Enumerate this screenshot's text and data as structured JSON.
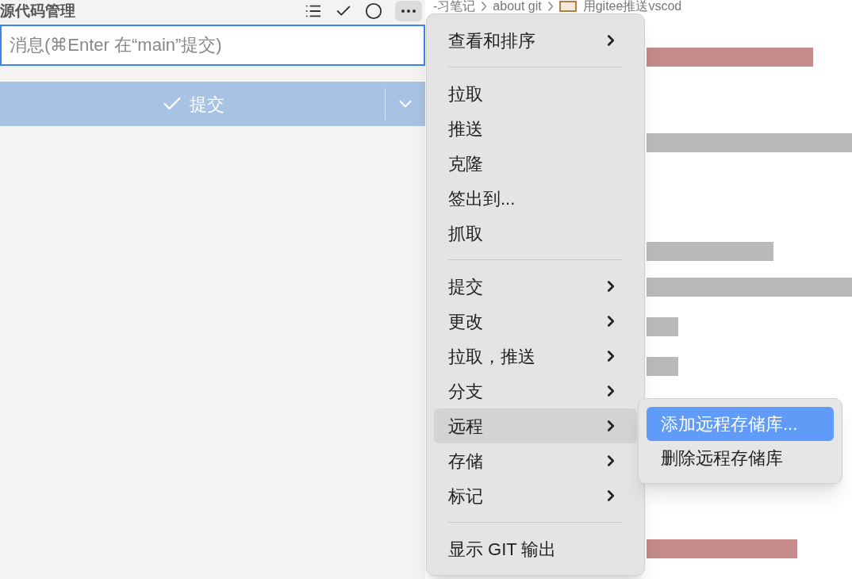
{
  "sidebar": {
    "title": "源代码管理",
    "message_field": {
      "placeholder": "消息(⌘Enter 在“main”提交)"
    },
    "commit_button": {
      "label": "提交"
    }
  },
  "breadcrumb": [
    "-习笔记",
    "about git",
    "用gitee推送vscod"
  ],
  "menu": {
    "sections": [
      [
        {
          "label": "查看和排序",
          "submenu": true,
          "selected": false
        }
      ],
      [
        {
          "label": "拉取",
          "submenu": false,
          "selected": false
        },
        {
          "label": "推送",
          "submenu": false,
          "selected": false
        },
        {
          "label": "克隆",
          "submenu": false,
          "selected": false
        },
        {
          "label": "签出到...",
          "submenu": false,
          "selected": false
        },
        {
          "label": "抓取",
          "submenu": false,
          "selected": false
        }
      ],
      [
        {
          "label": "提交",
          "submenu": true,
          "selected": false
        },
        {
          "label": "更改",
          "submenu": true,
          "selected": false
        },
        {
          "label": "拉取，推送",
          "submenu": true,
          "selected": false
        },
        {
          "label": "分支",
          "submenu": true,
          "selected": false
        },
        {
          "label": "远程",
          "submenu": true,
          "selected": true
        },
        {
          "label": "存储",
          "submenu": true,
          "selected": false
        },
        {
          "label": "标记",
          "submenu": true,
          "selected": false
        }
      ],
      [
        {
          "label": "显示 GIT 输出",
          "submenu": false,
          "selected": false
        }
      ]
    ]
  },
  "submenu": {
    "items": [
      {
        "label": "添加远程存储库...",
        "selected": true
      },
      {
        "label": "删除远程存储库",
        "selected": false
      }
    ]
  }
}
